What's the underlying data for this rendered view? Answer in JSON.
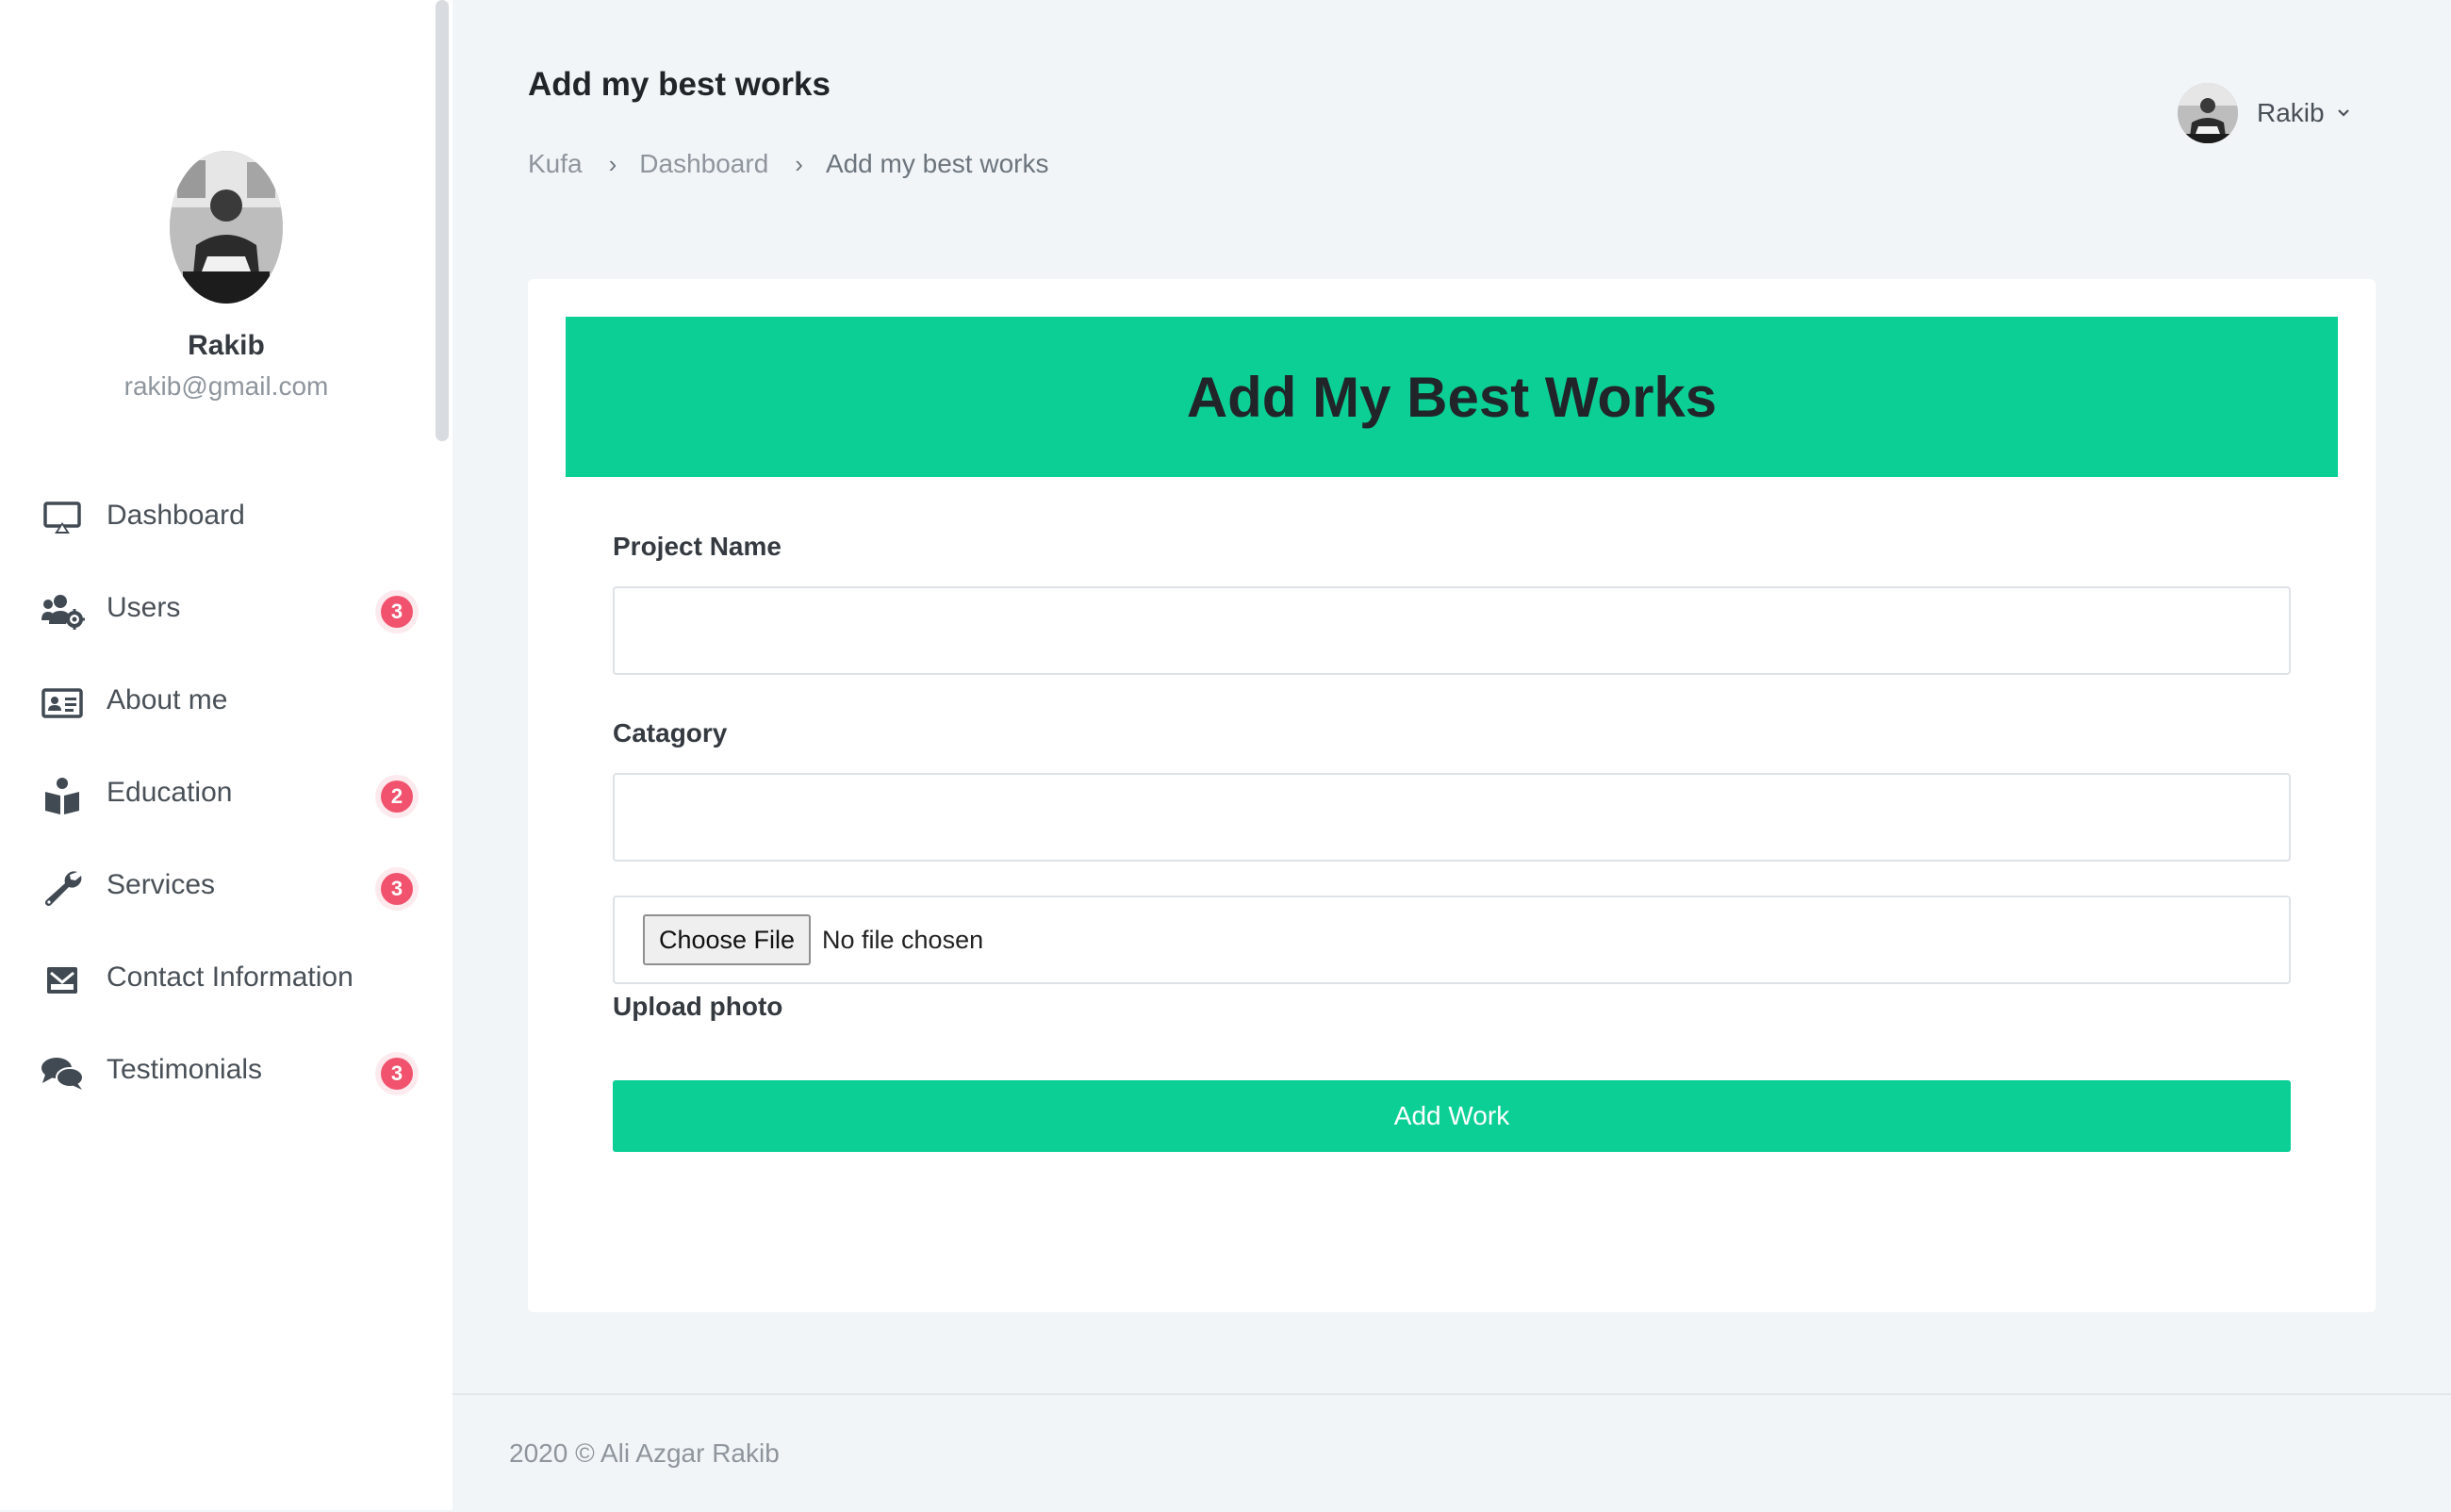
{
  "header": {
    "page_title": "Add my best works",
    "breadcrumb": [
      "Kufa",
      "Dashboard",
      "Add my best works"
    ],
    "breadcrumb_separator": "›",
    "user": {
      "name": "Rakib",
      "avatar_icon": "user-avatar-photo",
      "menu_icon": "chevron-down-icon"
    }
  },
  "profile": {
    "name": "Rakib",
    "email": "rakib@gmail.com",
    "avatar_icon": "user-avatar-photo"
  },
  "sidebar": {
    "items": [
      {
        "label": "Dashboard",
        "icon": "monitor-icon",
        "badge": null
      },
      {
        "label": "Users",
        "icon": "users-gear-icon",
        "badge": "3"
      },
      {
        "label": "About me",
        "icon": "id-card-icon",
        "badge": null
      },
      {
        "label": "Education",
        "icon": "reader-icon",
        "badge": "2"
      },
      {
        "label": "Services",
        "icon": "wrench-icon",
        "badge": "3"
      },
      {
        "label": "Contact Information",
        "icon": "envelope-icon",
        "badge": null
      },
      {
        "label": "Testimonials",
        "icon": "comments-icon",
        "badge": "3"
      }
    ]
  },
  "form": {
    "title": "Add My Best Works",
    "project_name_label": "Project Name",
    "project_name_value": "",
    "category_label": "Catagory",
    "category_value": "",
    "file_button_label": "Choose File",
    "file_status": "No file chosen",
    "upload_label": "Upload photo",
    "submit_label": "Add Work"
  },
  "footer": {
    "text": "2020 © Ali Azgar Rakib"
  },
  "colors": {
    "accent": "#0ccf95",
    "badge": "#f1536e",
    "page_background": "#f2f5f8"
  }
}
